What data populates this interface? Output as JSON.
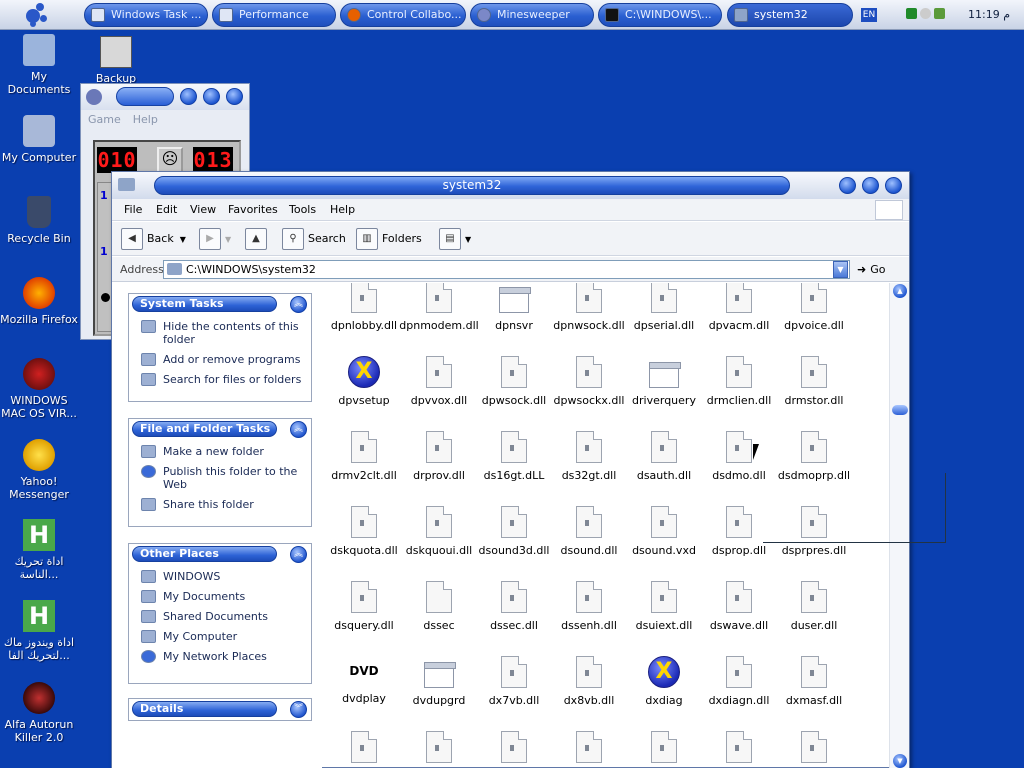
{
  "taskbar": {
    "buttons": [
      {
        "label": "Windows Task ...",
        "icon": "task-manager-icon"
      },
      {
        "label": "Performance",
        "icon": "performance-icon"
      },
      {
        "label": "Control Collabo...",
        "icon": "firefox-icon"
      },
      {
        "label": "Minesweeper",
        "icon": "minesweeper-icon"
      },
      {
        "label": "C:\\WINDOWS\\...",
        "icon": "cmd-icon"
      },
      {
        "label": "system32",
        "icon": "folder-icon"
      }
    ],
    "language": "EN",
    "clock": "11:19 م"
  },
  "desktop": {
    "icons": [
      {
        "label": "My Documents"
      },
      {
        "label": "Backup"
      },
      {
        "label": "My Computer"
      },
      {
        "label": "Recycle Bin"
      },
      {
        "label": "Mozilla Firefox"
      },
      {
        "label": "WINDOWS MAC OS VIR..."
      },
      {
        "label": "Yahoo! Messenger"
      },
      {
        "label": "اداة تحريك الناسة..."
      },
      {
        "label": "اداة ويندوز ماك لتحريك الفا..."
      },
      {
        "label": "Alfa Autorun Killer 2.0"
      }
    ]
  },
  "minesweeper": {
    "menu": [
      "Game",
      "Help"
    ],
    "mines_counter": "010",
    "timer": "013",
    "face": "☹",
    "cells": [
      "1",
      "1"
    ]
  },
  "explorer": {
    "title": "system32",
    "menu": [
      "File",
      "Edit",
      "View",
      "Favorites",
      "Tools",
      "Help"
    ],
    "toolbar": {
      "back": "Back",
      "search": "Search",
      "folders": "Folders"
    },
    "address_label": "Address",
    "address": "C:\\WINDOWS\\system32",
    "go": "Go",
    "panes": {
      "system_tasks": {
        "title": "System Tasks",
        "items": [
          "Hide the contents of this folder",
          "Add or remove programs",
          "Search for files or folders"
        ]
      },
      "file_folder_tasks": {
        "title": "File and Folder Tasks",
        "items": [
          "Make a new folder",
          "Publish this folder to the Web",
          "Share this folder"
        ]
      },
      "other_places": {
        "title": "Other Places",
        "items": [
          "WINDOWS",
          "My Documents",
          "Shared Documents",
          "My Computer",
          "My Network Places"
        ]
      },
      "details": {
        "title": "Details"
      }
    },
    "files": [
      {
        "name": "dpnlobby.dll",
        "kind": "dll"
      },
      {
        "name": "dpnmodem.dll",
        "kind": "dll"
      },
      {
        "name": "dpnsvr",
        "kind": "win"
      },
      {
        "name": "dpnwsock.dll",
        "kind": "dll"
      },
      {
        "name": "dpserial.dll",
        "kind": "dll"
      },
      {
        "name": "dpvacm.dll",
        "kind": "dll"
      },
      {
        "name": "dpvoice.dll",
        "kind": "dll"
      },
      {
        "name": "dpvsetup",
        "kind": "xico"
      },
      {
        "name": "dpvvox.dll",
        "kind": "dll"
      },
      {
        "name": "dpwsock.dll",
        "kind": "dll"
      },
      {
        "name": "dpwsockx.dll",
        "kind": "dll"
      },
      {
        "name": "driverquery",
        "kind": "win"
      },
      {
        "name": "drmclien.dll",
        "kind": "dll"
      },
      {
        "name": "drmstor.dll",
        "kind": "dll"
      },
      {
        "name": "drmv2clt.dll",
        "kind": "dll"
      },
      {
        "name": "drprov.dll",
        "kind": "dll"
      },
      {
        "name": "ds16gt.dLL",
        "kind": "dll"
      },
      {
        "name": "ds32gt.dll",
        "kind": "dll"
      },
      {
        "name": "dsauth.dll",
        "kind": "dll"
      },
      {
        "name": "dsdmo.dll",
        "kind": "dll"
      },
      {
        "name": "dsdmoprp.dll",
        "kind": "dll"
      },
      {
        "name": "dskquota.dll",
        "kind": "dll"
      },
      {
        "name": "dskquoui.dll",
        "kind": "dll"
      },
      {
        "name": "dsound3d.dll",
        "kind": "dll"
      },
      {
        "name": "dsound.dll",
        "kind": "dll"
      },
      {
        "name": "dsound.vxd",
        "kind": "dll"
      },
      {
        "name": "dsprop.dll",
        "kind": "dll"
      },
      {
        "name": "dsprpres.dll",
        "kind": "dll"
      },
      {
        "name": "dsquery.dll",
        "kind": "dll"
      },
      {
        "name": "dssec",
        "kind": "plain"
      },
      {
        "name": "dssec.dll",
        "kind": "dll"
      },
      {
        "name": "dssenh.dll",
        "kind": "dll"
      },
      {
        "name": "dsuiext.dll",
        "kind": "dll"
      },
      {
        "name": "dswave.dll",
        "kind": "dll"
      },
      {
        "name": "duser.dll",
        "kind": "dll"
      },
      {
        "name": "dvdplay",
        "kind": "dvd"
      },
      {
        "name": "dvdupgrd",
        "kind": "win"
      },
      {
        "name": "dx7vb.dll",
        "kind": "dll"
      },
      {
        "name": "dx8vb.dll",
        "kind": "dll"
      },
      {
        "name": "dxdiag",
        "kind": "xico"
      },
      {
        "name": "dxdiagn.dll",
        "kind": "dll"
      },
      {
        "name": "dxmasf.dll",
        "kind": "dll"
      },
      {
        "name": "",
        "kind": "dll"
      },
      {
        "name": "",
        "kind": "dll"
      },
      {
        "name": "",
        "kind": "dll"
      },
      {
        "name": "",
        "kind": "dll"
      },
      {
        "name": "",
        "kind": "dll"
      },
      {
        "name": "",
        "kind": "dll"
      },
      {
        "name": "",
        "kind": "dll"
      }
    ]
  }
}
